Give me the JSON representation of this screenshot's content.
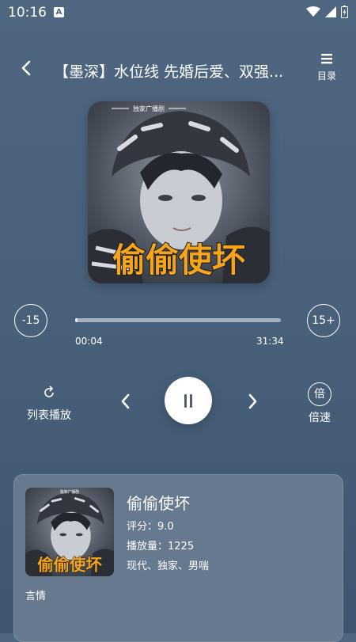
{
  "status_bar": {
    "time": "10:16",
    "notification_badge": "A"
  },
  "header": {
    "title": "【墨深】水位线 先婚后爱、双强...",
    "toc_label": "目录"
  },
  "cover": {
    "label": "独家广播剧",
    "big_text": "偷偷使坏"
  },
  "player": {
    "rewind_label": "-15",
    "forward_label": "15+",
    "current_time": "00:04",
    "total_time": "31:34",
    "progress": 0.002,
    "repeat_label": "列表播放",
    "speed_icon_text": "倍",
    "speed_label": "倍速"
  },
  "info": {
    "title": "偷偷使坏",
    "rating": "评分：9.0",
    "plays": "播放量：1225",
    "tags": "现代、独家、男喘",
    "description": "言情",
    "thumb_text": "偷偷使坏",
    "thumb_label": "独家广播剧"
  },
  "colors": {
    "background_top": "#4f6680",
    "background_bottom": "#3f566f",
    "card": "#66798f",
    "progress_track": "#a2b0bf",
    "cover_text": "#f4a51c"
  }
}
